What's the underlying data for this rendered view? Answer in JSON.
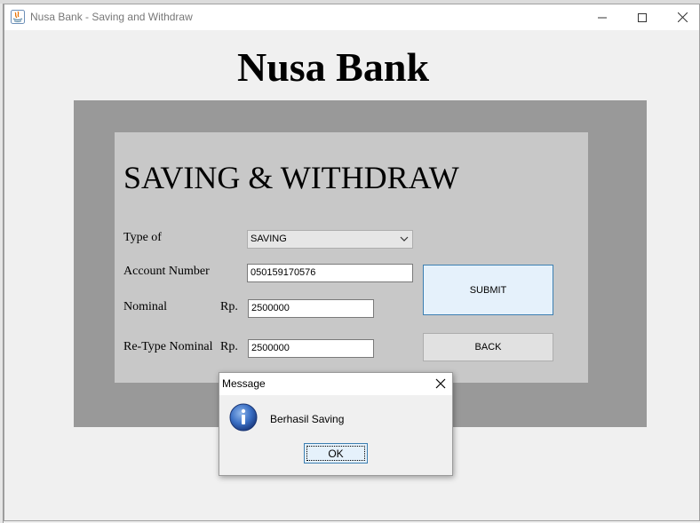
{
  "window": {
    "title": "Nusa Bank - Saving and Withdraw",
    "controls": [
      "minimize-icon",
      "maximize-icon",
      "close-icon"
    ]
  },
  "heading": "Nusa Bank",
  "form": {
    "title": "SAVING & WITHDRAW",
    "type_label": "Type of",
    "type_value": "SAVING",
    "account_label": "Account Number",
    "account_value": "050159170576",
    "nominal_label": "Nominal",
    "nominal_currency": "Rp.",
    "nominal_value": "2500000",
    "retype_label": "Re-Type Nominal",
    "retype_currency": "Rp.",
    "retype_value": "2500000",
    "submit_label": "SUBMIT",
    "back_label": "BACK"
  },
  "dialog": {
    "title": "Message",
    "icon": "information-icon",
    "message": "Berhasil Saving",
    "ok_label": "OK"
  },
  "colors": {
    "outer_panel": "#999999",
    "inner_panel": "#c8c8c8",
    "focus_button": "#e5f1fb",
    "focus_border": "#3c7fb1"
  }
}
